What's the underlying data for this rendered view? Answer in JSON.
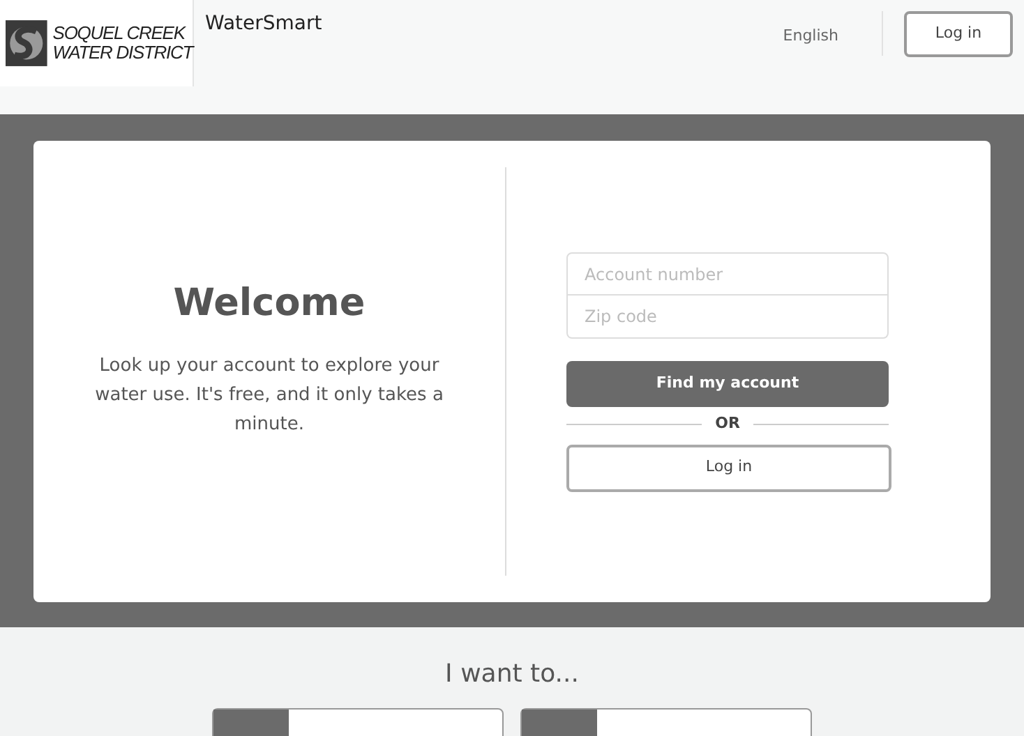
{
  "header": {
    "logo_lines": [
      "SOQUEL CREEK",
      "WATER DISTRICT"
    ],
    "app_name": "WaterSmart",
    "language": "English",
    "login_button": "Log in"
  },
  "welcome": {
    "title": "Welcome",
    "text": "Look up your account to explore your water use. It's free, and it only takes a minute."
  },
  "form": {
    "fields": [
      {
        "placeholder": "Account number"
      },
      {
        "placeholder": "Zip code"
      }
    ],
    "submit": "Find my account",
    "separator": "OR",
    "login_button": "Log in"
  },
  "actions": {
    "title": "I want to..."
  }
}
